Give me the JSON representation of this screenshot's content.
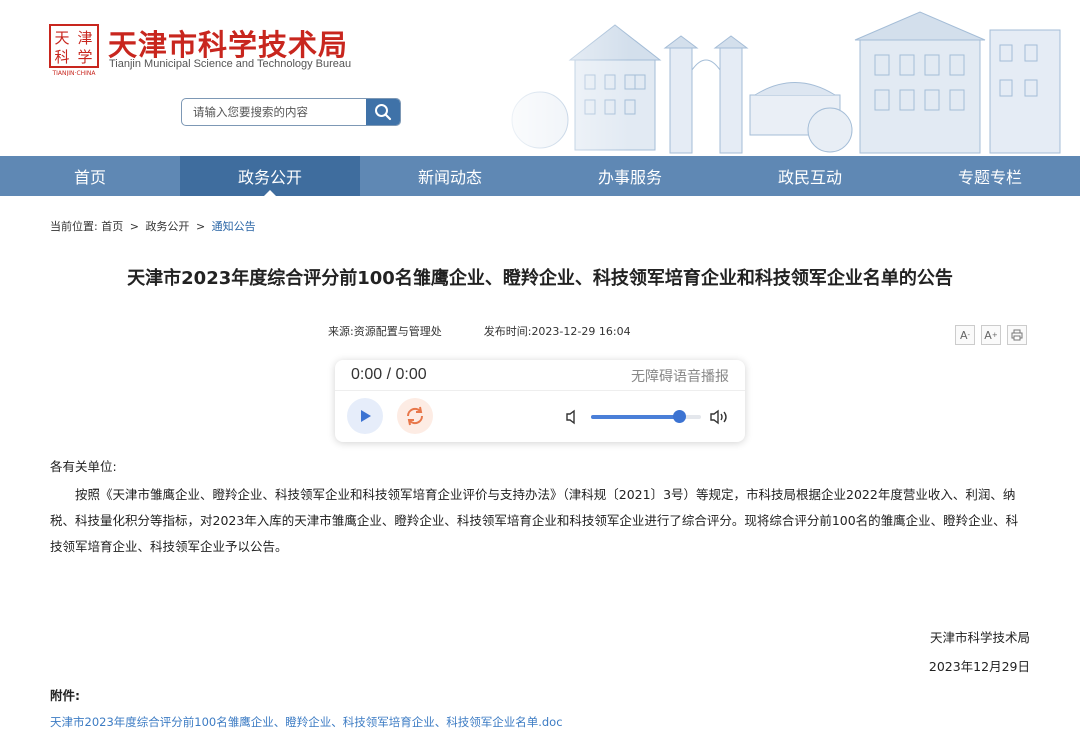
{
  "site": {
    "seal_chars": [
      "天",
      "津",
      "科",
      "学"
    ],
    "seal_caption": "TIANJIN·CHINA",
    "title": "天津市科学技术局",
    "subtitle": "Tianjin Municipal Science and Technology Bureau",
    "brand_color": "#c8261e"
  },
  "search": {
    "placeholder": "请输入您要搜索的内容",
    "icon": "search-icon"
  },
  "nav": {
    "items": [
      {
        "label": "首页"
      },
      {
        "label": "政务公开"
      },
      {
        "label": "新闻动态"
      },
      {
        "label": "办事服务"
      },
      {
        "label": "政民互动"
      },
      {
        "label": "专题专栏"
      }
    ],
    "active_index": 1,
    "bar_color": "#5f88b4",
    "active_color": "#3f6d9e"
  },
  "breadcrumb": {
    "prefix": "当前位置:",
    "items": [
      "首页",
      "政务公开",
      "通知公告"
    ],
    "separator": ">"
  },
  "article": {
    "title": "天津市2023年度综合评分前100名雏鹰企业、瞪羚企业、科技领军培育企业和科技领军企业名单的公告",
    "source_label": "来源:",
    "source": "资源配置与管理处",
    "published_label": "发布时间:",
    "published": "2023-12-29 16:04",
    "tools": {
      "font_smaller": "A",
      "font_larger": "A",
      "print_icon": "print-icon"
    },
    "salutation": "各有关单位:",
    "body": "按照《天津市雏鹰企业、瞪羚企业、科技领军企业和科技领军培育企业评价与支持办法》（津科规〔2021〕3号）等规定，市科技局根据企业2022年度营业收入、利润、纳税、科技量化积分等指标，对2023年入库的天津市雏鹰企业、瞪羚企业、科技领军培育企业和科技领军企业进行了综合评分。现将综合评分前100名的雏鹰企业、瞪羚企业、科技领军培育企业、科技领军企业予以公告。",
    "signer": "天津市科学技术局",
    "date": "2023年12月29日",
    "attachment_label": "附件:",
    "attachment_name": "天津市2023年度综合评分前100名雏鹰企业、瞪羚企业、科技领军培育企业、科技领军企业名单.doc"
  },
  "audio": {
    "time": "0:00 / 0:00",
    "label": "无障碍语音播报",
    "volume_fraction": 0.8,
    "accent": "#3c73d2"
  }
}
